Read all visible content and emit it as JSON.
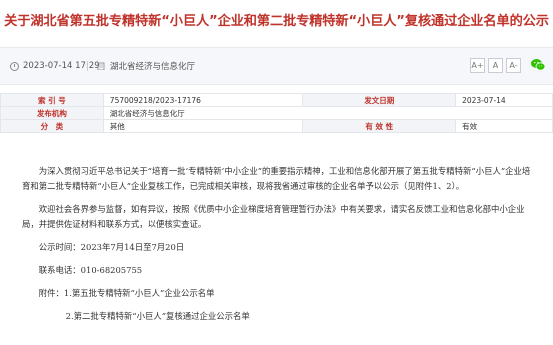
{
  "title": "关于湖北省第五批专精特新“小巨人”企业和第二批专精特新“小巨人”复核通过企业名单的公示",
  "meta": {
    "datetime": "2023-07-14 17:29",
    "department": "湖北省经济与信息化厅",
    "font_buttons": [
      "A+",
      "A",
      "A-"
    ],
    "share_icon": "wechat-icon"
  },
  "info_table": {
    "rows": [
      {
        "label1": "索 引 号",
        "value1": "757009218/2023-17176",
        "label2": "发文日期",
        "value2": "2023-07-14"
      },
      {
        "label1": "发布机构",
        "value1": "湖北省经济与信息化厅",
        "label2": "",
        "value2": ""
      },
      {
        "label1": "分　类",
        "value1": "其他",
        "label2": "有 效 性",
        "value2": "有效"
      }
    ]
  },
  "body": {
    "para1": "为深入贯彻习近平总书记关于“培育一批‘专精特新’中小企业”的重要指示精神，工业和信息化部开展了第五批专精特新“小巨人”企业培育和第二批专精特新“小巨人”企业复核工作，已完成相关审核，现将我省通过审核的企业名单予以公示（见附件1、2）。",
    "para2": "欢迎社会各界参与监督，如有异议，按照《优质中小企业梯度培育管理暂行办法》中有关要求，请实名反馈工业和信息化部中小企业局，并提供佐证材料和联系方式，以便核实查证。",
    "period": "公示时间：2023年7月14日至7月20日",
    "phone": "联系电话：010-68205755",
    "attach1": "附件：1.第五批专精特新“小巨人”企业公示名单",
    "attach2": "2.第二批专精特新“小巨人”复核通过企业公示名单"
  }
}
